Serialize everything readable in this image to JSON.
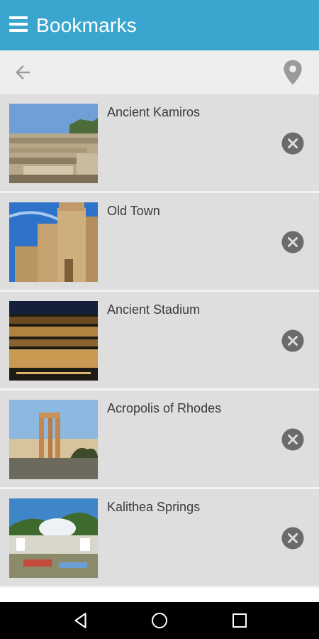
{
  "app_bar": {
    "title": "Bookmarks",
    "menu_icon": "hamburger-menu-icon",
    "color": "#3aa6cf"
  },
  "toolbar": {
    "back_icon": "arrow-left-icon",
    "location_icon": "map-pin-icon"
  },
  "bookmarks": [
    {
      "title": "Ancient Kamiros"
    },
    {
      "title": "Old Town"
    },
    {
      "title": "Ancient Stadium"
    },
    {
      "title": "Acropolis of Rhodes"
    },
    {
      "title": "Kalithea Springs"
    }
  ],
  "item_action_icon": "remove-circle-icon",
  "nav_bar": {
    "back": "nav-back-icon",
    "home": "nav-home-icon",
    "recents": "nav-recents-icon"
  }
}
